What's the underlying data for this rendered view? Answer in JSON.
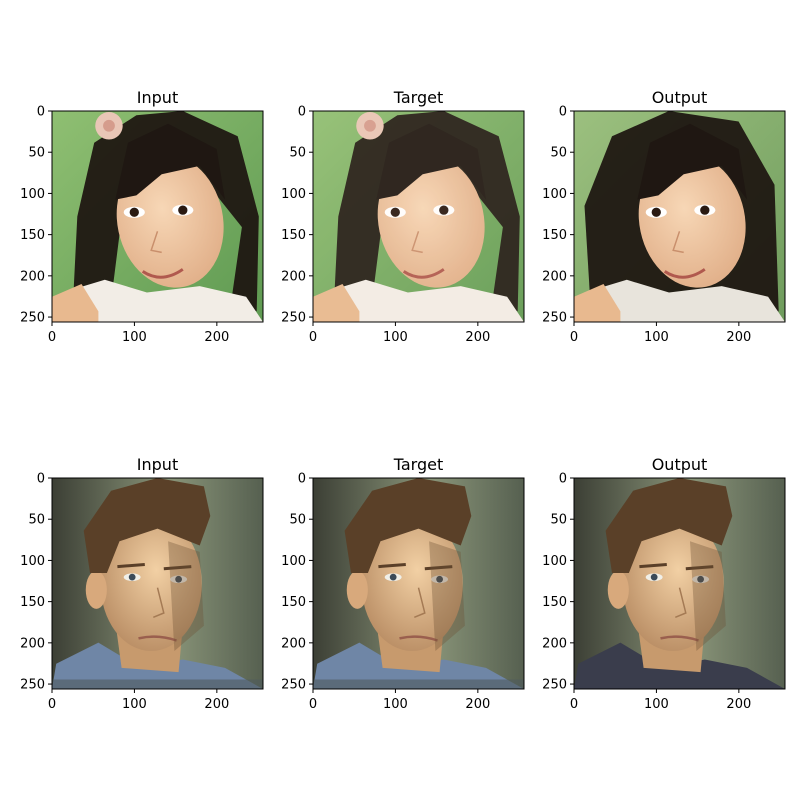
{
  "figure": {
    "panels": [
      {
        "title": "Input",
        "subject": "woman",
        "variant": "input"
      },
      {
        "title": "Target",
        "subject": "woman",
        "variant": "target"
      },
      {
        "title": "Output",
        "subject": "woman",
        "variant": "output"
      },
      {
        "title": "Input",
        "subject": "man",
        "variant": "input"
      },
      {
        "title": "Target",
        "subject": "man",
        "variant": "target"
      },
      {
        "title": "Output",
        "subject": "man",
        "variant": "output"
      }
    ],
    "x_ticks": [
      "0",
      "100",
      "200"
    ],
    "x_tick_values": [
      0,
      100,
      200
    ],
    "y_ticks": [
      "0",
      "50",
      "100",
      "150",
      "200",
      "250"
    ],
    "y_tick_values": [
      0,
      50,
      100,
      150,
      200,
      250
    ],
    "image_extent": [
      0,
      256
    ],
    "colors": {
      "woman_background": "#8fbf72",
      "woman_hair": "#1f1712",
      "woman_skin": "#f0c9a4",
      "man_background": "#6e7a60",
      "man_hair": "#5a4028",
      "man_skin": "#e6bf92",
      "man_shirt": "#6f86a6"
    }
  }
}
